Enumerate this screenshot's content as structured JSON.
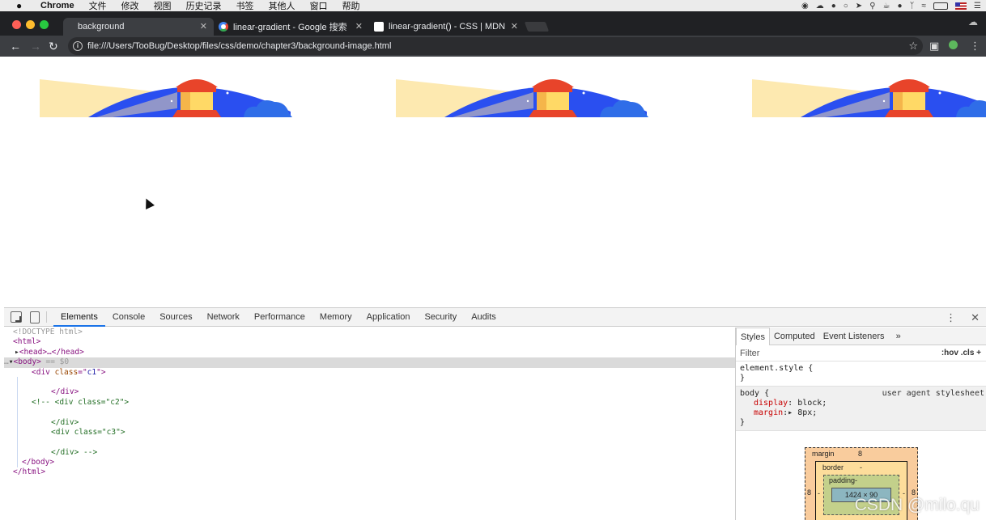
{
  "menubar": {
    "app": "Chrome",
    "items": [
      "文件",
      "修改",
      "视图",
      "历史记录",
      "书签",
      "其他人",
      "窗口",
      "帮助"
    ]
  },
  "tabs": [
    {
      "title": "background",
      "favicon": "page-icon",
      "active": true
    },
    {
      "title": "linear-gradient - Google 搜索",
      "favicon": "google-icon",
      "active": false
    },
    {
      "title": "linear-gradient() - CSS | MDN",
      "favicon": "mdn-icon",
      "active": false
    }
  ],
  "address_bar": {
    "url": "file:///Users/TooBug/Desktop/files/css/demo/chapter3/background-image.html"
  },
  "devtools": {
    "tabs": [
      "Elements",
      "Console",
      "Sources",
      "Network",
      "Performance",
      "Memory",
      "Application",
      "Security",
      "Audits"
    ],
    "active_tab": "Elements",
    "dom_lines": {
      "doctype": "<!DOCTYPE html>",
      "html_open": "<html>",
      "head": "<head>…</head>",
      "body_open": "<body>",
      "body_sel": " == $0",
      "div_c1": "c1",
      "div_close": "</div>",
      "comment_open": "<!-- ",
      "div_c2": "c2",
      "div_c3": "c3",
      "comment_close": " -->",
      "body_close": "</body>",
      "html_close": "</html>"
    },
    "styles": {
      "tabs": [
        "Styles",
        "Computed",
        "Event Listeners"
      ],
      "more": "»",
      "filter_placeholder": "Filter",
      "filter_tools": ":hov  .cls  +",
      "element_style": "element.style {",
      "close_brace": "}",
      "body_selector": "body {",
      "ua_source": "user agent stylesheet",
      "props": [
        {
          "name": "display",
          "value": "block;"
        },
        {
          "name": "margin",
          "value": "8px;"
        }
      ]
    },
    "box_model": {
      "margin_label": "margin",
      "margin_value": "8",
      "border_label": "border",
      "border_value": "-",
      "padding_label": "padding-",
      "content": "1424 × 90",
      "side_left": "8",
      "side_right": "8",
      "dash_left": "-",
      "dash_right": "-"
    }
  },
  "watermark": "CSDN @milo.qu",
  "colors": {
    "tabstrip": "#202124",
    "toolbar": "#3c3e42",
    "omnibox": "#2b2c2f",
    "devtools_active_tab": "#1a73e8",
    "sky_blue": "#2a4ff0",
    "beam": "#fde9b0",
    "tower_red": "#e8442a",
    "tower_yellow": "#ffd966",
    "cloud_blue": "#2f6de8"
  }
}
